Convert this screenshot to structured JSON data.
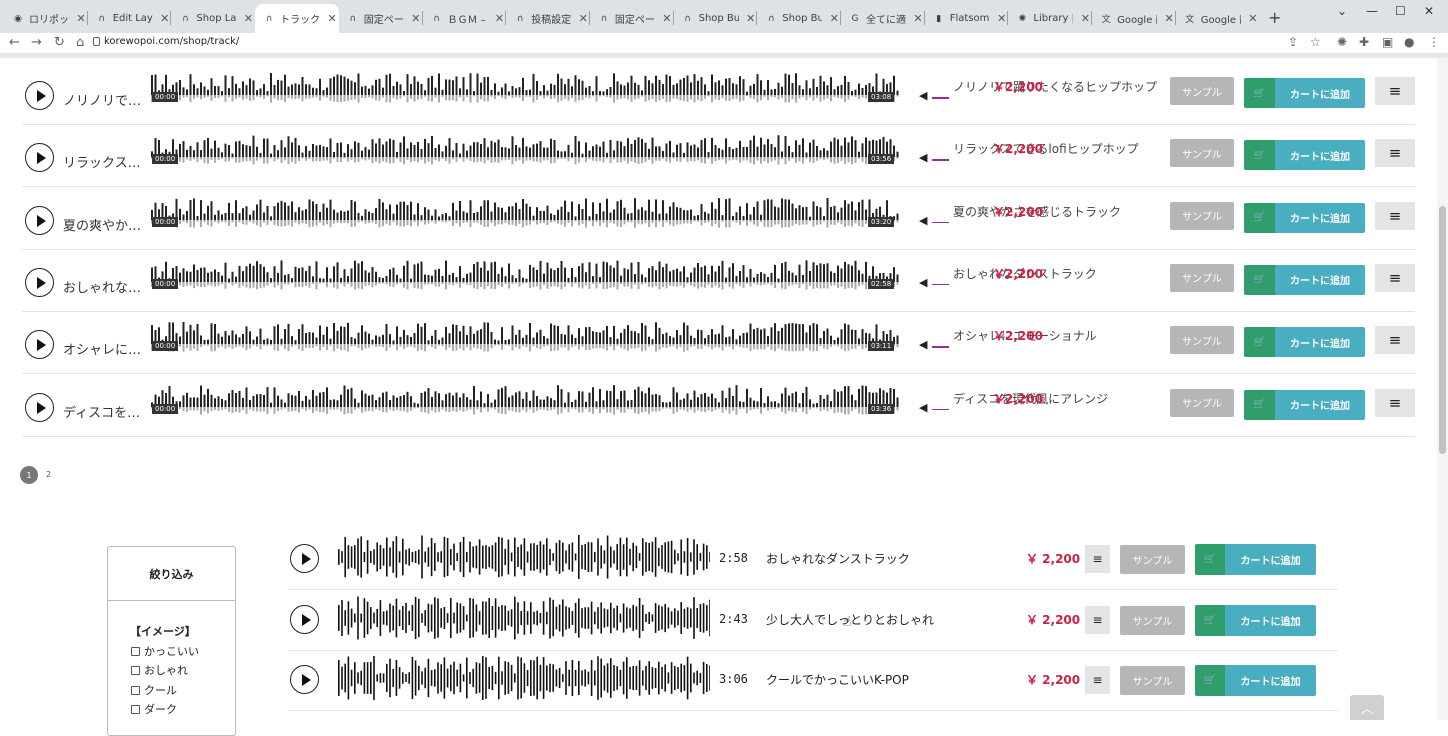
{
  "browser": {
    "tabs": [
      {
        "title": "ロリポップ！",
        "favicon": "lolipop-icon"
      },
      {
        "title": "Edit Layout",
        "favicon": "headphones-icon"
      },
      {
        "title": "Shop Layout",
        "favicon": "headphones-icon"
      },
      {
        "title": "トラック – こ",
        "favicon": "headphones-icon",
        "active": true
      },
      {
        "title": "固定ページ",
        "favicon": "headphones-icon"
      },
      {
        "title": "ＢＧＭ – こ",
        "favicon": "headphones-icon"
      },
      {
        "title": "投稿設定",
        "favicon": "headphones-icon"
      },
      {
        "title": "固定ページ",
        "favicon": "headphones-icon"
      },
      {
        "title": "Shop Build",
        "favicon": "headphones-icon"
      },
      {
        "title": "Shop Build",
        "favicon": "headphones-icon"
      },
      {
        "title": "全てに適応",
        "favicon": "google-icon"
      },
      {
        "title": "Flatsome",
        "favicon": "flatsome-icon"
      },
      {
        "title": "Library | Lo",
        "favicon": "react-icon"
      },
      {
        "title": "Google 翻",
        "favicon": "translate-icon"
      },
      {
        "title": "Google 翻",
        "favicon": "translate-icon"
      }
    ],
    "url": "korewopoi.com/shop/track/"
  },
  "tracks": [
    {
      "title": "ノリノリで…",
      "start": "00:00",
      "end": "03:08",
      "name": "ノリノリで踊りたくなるヒップホップ",
      "price": "￥2,200"
    },
    {
      "title": "リラックス…",
      "start": "00:00",
      "end": "03:56",
      "name": "リラックスできるlofiヒップホップ",
      "price": "￥2,200"
    },
    {
      "title": "夏の爽やか…",
      "start": "00:00",
      "end": "03:20",
      "name": "夏の爽やかさを感じるトラック",
      "price": "￥2,200"
    },
    {
      "title": "おしゃれな…",
      "start": "00:00",
      "end": "02:58",
      "name": "おしゃれなダンストラック",
      "price": "￥2,200"
    },
    {
      "title": "オシャレに…",
      "start": "00:00",
      "end": "03:11",
      "name": "オシャレにエモーショナル",
      "price": "￥2,200"
    },
    {
      "title": "ディスコを…",
      "start": "00:00",
      "end": "03:36",
      "name": "ディスコを現代風にアレンジ",
      "price": "￥2,200"
    }
  ],
  "labels": {
    "sample": "サンプル",
    "add_to_cart": "カートに追加",
    "menu_glyph": "≡",
    "cart_glyph": "🛒",
    "volume_glyph": "◀"
  },
  "pagination": {
    "current": "1",
    "next": "2"
  },
  "filter": {
    "title": "絞り込み",
    "group": "【イメージ】",
    "options": [
      "かっこいい",
      "おしゃれ",
      "クール",
      "ダーク"
    ]
  },
  "products": [
    {
      "duration": "2:58",
      "name": "おしゃれなダンストラック",
      "price": "￥ 2,200"
    },
    {
      "duration": "2:43",
      "name": "少し大人でしっとりとおしゃれ",
      "price": "￥ 2,200"
    },
    {
      "duration": "3:06",
      "name": "クールでかっこいいK-POP",
      "price": "￥ 2,200"
    }
  ],
  "colors": {
    "cart_green": "#2f9e6c",
    "cart_blue": "#4aaec1",
    "price_red": "#cc2244",
    "sample_gray": "#b6b6b6",
    "volume_purple": "#9a2b9a"
  }
}
